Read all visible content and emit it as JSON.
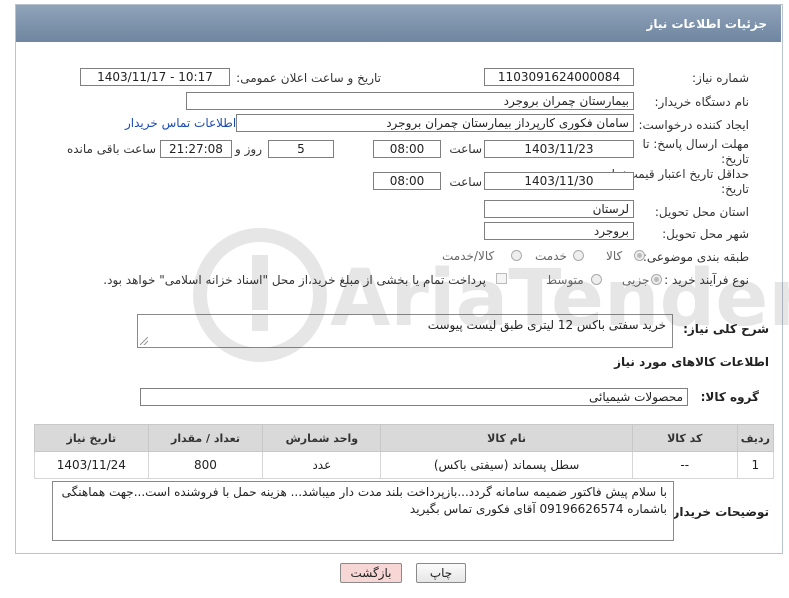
{
  "header": {
    "title": "جزئیات اطلاعات نیاز"
  },
  "fields": {
    "need_number_label": "شماره نیاز:",
    "need_number": "1103091624000084",
    "announce_label": "تاریخ و ساعت اعلان عمومی:",
    "announce_value": "1403/11/17 - 10:17",
    "buyer_org_label": "نام دستگاه خریدار:",
    "buyer_org": "بیمارستان چمران بروجرد",
    "creator_label": "ایجاد کننده درخواست:",
    "creator": "سامان فکوری کارپرداز بیمارستان چمران بروجرد",
    "contact_link": "اطلاعات تماس خریدار",
    "reply_deadline_label": "مهلت ارسال پاسخ: تا تاریخ:",
    "reply_date": "1403/11/23",
    "time_label": "ساعت",
    "reply_time": "08:00",
    "days_count": "5",
    "days_and_label": "روز و",
    "remaining_time": "21:27:08",
    "remaining_label": "ساعت باقی مانده",
    "price_validity_label": "حداقل تاریخ اعتبار قیمت: تا تاریخ:",
    "price_date": "1403/11/30",
    "price_time": "08:00",
    "province_label": "استان محل تحویل:",
    "province": "لرستان",
    "city_label": "شهر محل تحویل:",
    "city": "بروجرد",
    "category_label": "طبقه بندی موضوعی:",
    "category_options": [
      "کالا",
      "خدمت",
      "کالا/خدمت"
    ],
    "process_label": "نوع فرآیند خرید :",
    "process_options": [
      "جزیی",
      "متوسط"
    ],
    "payment_note": "پرداخت تمام یا بخشی از مبلغ خرید،از محل \"اسناد خزانه اسلامی\" خواهد بود."
  },
  "description": {
    "label": "شرح کلی نیاز:",
    "text": "خرید سفتی باکس 12 لیتری طبق لیست پیوست"
  },
  "goods_section_title": "اطلاعات کالاهای مورد نیاز",
  "goods_group": {
    "label": "گروه کالا:",
    "value": "محصولات شیمیائی"
  },
  "table": {
    "headers": [
      "ردیف",
      "کد کالا",
      "نام کالا",
      "واحد شمارش",
      "تعداد / مقدار",
      "تاریخ نیاز"
    ],
    "rows": [
      [
        "1",
        "--",
        "سطل پسماند (سیفتی باکس)",
        "عدد",
        "800",
        "1403/11/24"
      ]
    ]
  },
  "buyer_notes": {
    "label": "توضیحات خریدار:",
    "text": "با سلام پیش فاکتور ضمیمه سامانه گردد...بازپرداخت بلند مدت دار میباشد... هزینه حمل با فروشنده است...جهت هماهنگی باشماره 09196626574 آقای فکوری تماس بگیرید"
  },
  "buttons": {
    "print": "چاپ",
    "back": "بازگشت"
  },
  "watermark": {
    "text": "AriaTender.net"
  },
  "colors": {
    "header": "#7d91aa",
    "link": "#1a4cb0",
    "back_button_bg": "#f7d6d6"
  }
}
